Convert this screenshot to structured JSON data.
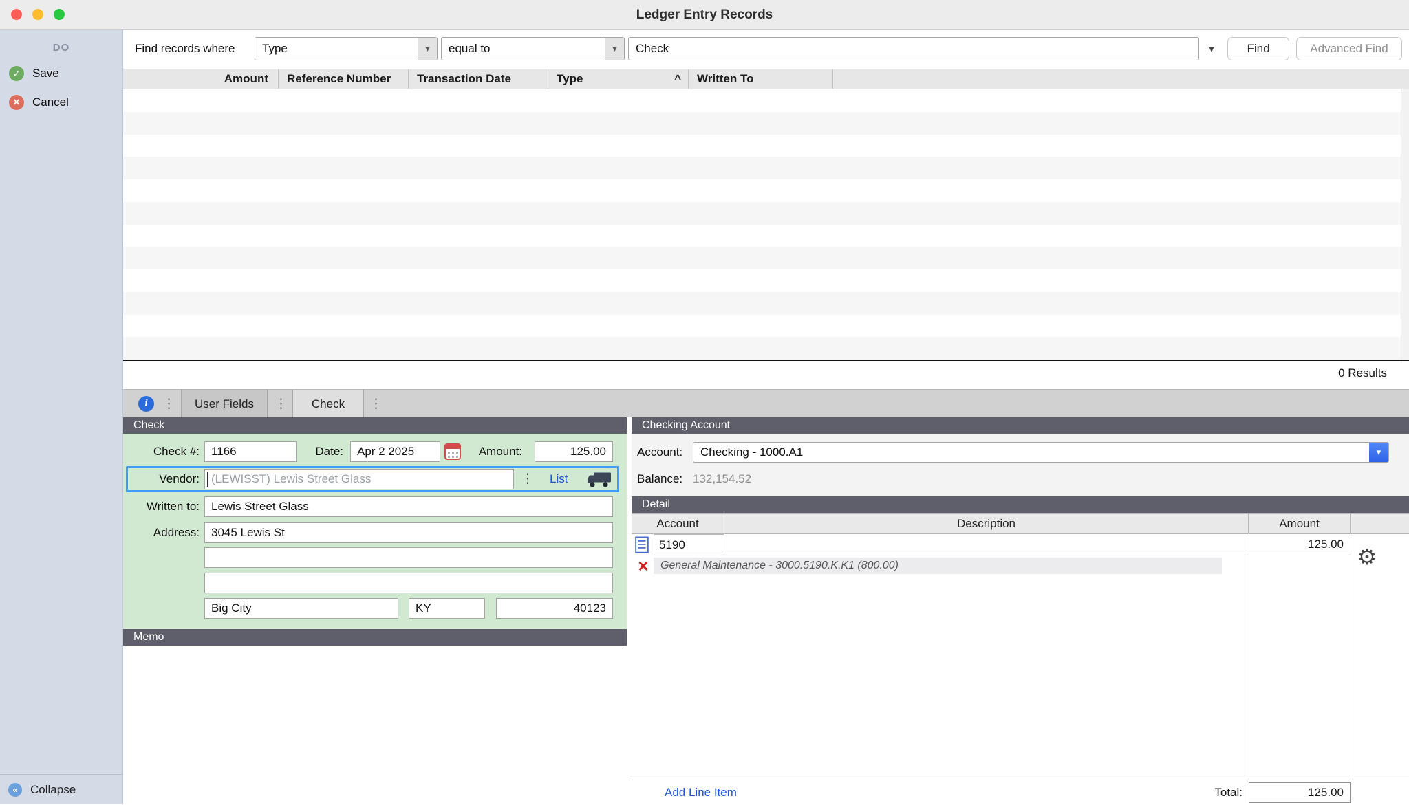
{
  "colors": {
    "traffic_red": "#ff5f57",
    "traffic_yellow": "#febc2e",
    "traffic_green": "#28c840",
    "header_slate": "#5e5f6b",
    "form_green": "#d0e9d0",
    "highlight_blue": "#3f9cf7",
    "accent_blue": "#2e62e9",
    "link_blue": "#1f55e0"
  },
  "window": {
    "title": "Ledger Entry Records"
  },
  "sidebar": {
    "header": "DO",
    "save_label": "Save",
    "cancel_label": "Cancel",
    "collapse_label": "Collapse"
  },
  "search": {
    "label": "Find records where",
    "field_selected": "Type",
    "operator_selected": "equal to",
    "value": "Check",
    "find_label": "Find",
    "advanced_find_label": "Advanced Find",
    "results_count": "0 Results"
  },
  "results_table": {
    "columns": [
      "Amount",
      "Reference Number",
      "Transaction Date",
      "Type",
      "Written To"
    ],
    "sorted_column": "Type"
  },
  "tabs": {
    "user_fields": "User Fields",
    "check": "Check",
    "active": "Check"
  },
  "check_form": {
    "header": "Check",
    "check_number_label": "Check #:",
    "check_number": "1166",
    "date_label": "Date:",
    "date": "Apr 2 2025",
    "amount_label": "Amount:",
    "amount": "125.00",
    "vendor_label": "Vendor:",
    "vendor": "(LEWISST) Lewis Street Glass",
    "list_link": "List",
    "written_to_label": "Written to:",
    "written_to": "Lewis Street Glass",
    "address_label": "Address:",
    "address_line_1": "3045 Lewis St",
    "address_line_2": "",
    "address_line_3": "",
    "city": "Big City",
    "state": "KY",
    "zip": "40123"
  },
  "memo": {
    "header": "Memo",
    "text": ""
  },
  "checking_account": {
    "header": "Checking Account",
    "account_label": "Account:",
    "account": "Checking - 1000.A1",
    "balance_label": "Balance:",
    "balance": "132,154.52"
  },
  "detail": {
    "header": "Detail",
    "columns": [
      "Account",
      "Description",
      "Amount"
    ],
    "line_items": [
      {
        "account": "5190",
        "description": "",
        "amount": "125.00",
        "account_note": "General Maintenance - 3000.5190.K.K1 (800.00)"
      }
    ],
    "add_line_item_label": "Add Line Item",
    "total_label": "Total:",
    "total": "125.00"
  },
  "icons": {
    "save_check": "✓",
    "cancel_x": "×",
    "collapse_chevrons": "«",
    "info": "i",
    "drag_handle_dots": "⋮",
    "dropdown_arrow": "▾",
    "disclosure_arrow": "▾",
    "sort_ascending": "^",
    "gear": "⚙",
    "delete_x": "×"
  }
}
